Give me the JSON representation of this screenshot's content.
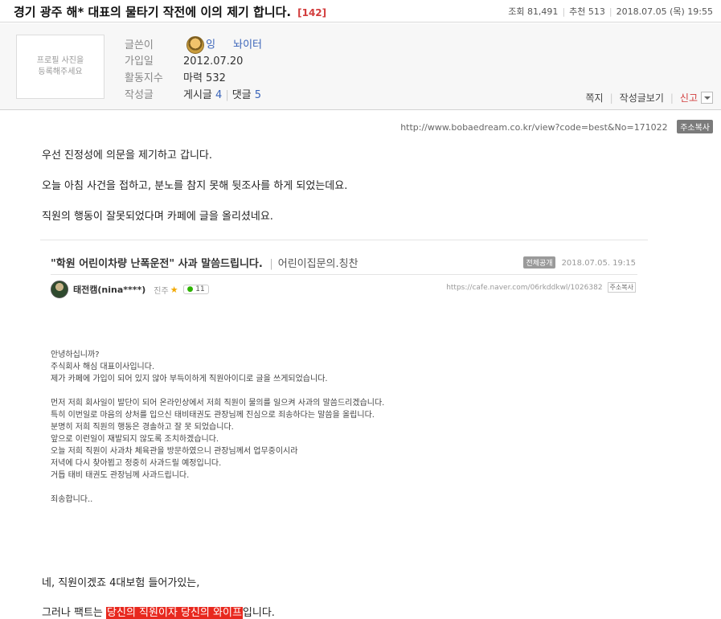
{
  "header": {
    "title": "경기 광주 해* 대표의 물타기 작전에 이의 제기 합니다.",
    "comment_count": "[142]",
    "views": "조회 81,491",
    "recommends": "추천 513",
    "date": "2018.07.05 (목) 19:55"
  },
  "profile": {
    "photo_placeholder": "프로필 사진을 등록해주세요",
    "writer_label": "글쓴이",
    "writer_name_a": "잉",
    "writer_name_b": "놔이터",
    "joined_label": "가입일",
    "joined_value": "2012.07.20",
    "activity_label": "활동지수",
    "activity_value": "마력 532",
    "posts_label": "작성글",
    "posts_text": "게시글",
    "posts_count": "4",
    "comments_text": "댓글",
    "comments_count": "5",
    "actions": {
      "message": "쪽지",
      "view_posts": "작성글보기",
      "report": "신고"
    }
  },
  "url_line": {
    "url": "http://www.bobaedream.co.kr/view?code=best&No=171022",
    "copy_label": "주소복사"
  },
  "article": {
    "p1": "우선 진정성에 의문을 제기하고 갑니다.",
    "p2": "오늘 아침 사건을 접하고, 분노를 참지 못해 뒷조사를 하게 되었는데요.",
    "p3": "직원의 행동이 잘못되었다며 카페에 글을 올리셨네요.",
    "p4": "네, 직원이겠죠 4대보험 들어가있는,",
    "p5_pre": "그러나 팩트는 ",
    "p5_highlight": "당신의 직원이자 당신의 와이프",
    "p5_post": "입니다."
  },
  "embed": {
    "title": "\"학원 어린이차량 난폭운전\" 사과 말씀드립니다.",
    "category": "어린이집문의.칭찬",
    "public_badge": "전체공개",
    "datetime": "2018.07.05. 19:15",
    "author": "태전캠(nina****)",
    "grade": "진주",
    "star": "★",
    "chat_count": "11",
    "url": "https://cafe.naver.com/06rkddkwl/1026382",
    "copy_label": "주소복사",
    "body": [
      "안녕하십니까?",
      "주식회사 해심 대표이사입니다.",
      "제가 카페에 가입이 되어 있지 않아 부득이하게 직원아이디로 글을 쓰게되었습니다.",
      "",
      "먼저 저희 회사일이 발단이 되어 온라인상에서 저희 직원이 물의를 일으켜 사과의 말씀드리겠습니다.",
      "특히 이번일로 마음의 상처를 입으신 태비태권도 관장님께 진심으로 죄송하다는 말씀을 올립니다.",
      "분명히 저희 직원의 행동은 경솔하고 잘 못 되었습니다.",
      "앞으로 이런일이 재발되지 않도록 조치하겠습니다.",
      "오늘 저희 직원이 사과차 체육관을 방문하였으니 관장님께서 업무중이시라",
      "저녁에 다시 찾아뵙고 정중히 사과드릴 예정입니다.",
      "거듭 태비 태권도 관장님께 사과드립니다.",
      "",
      "죄송합니다.."
    ]
  }
}
